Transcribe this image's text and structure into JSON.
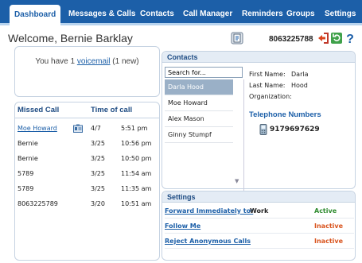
{
  "nav": {
    "tabs": [
      {
        "label": "Dashboard"
      },
      {
        "label": "Messages & Calls"
      },
      {
        "label": "Contacts"
      },
      {
        "label": "Call Manager"
      },
      {
        "label": "Reminders"
      },
      {
        "label": "Groups"
      },
      {
        "label": "Settings"
      }
    ]
  },
  "header": {
    "welcome": "Welcome, Bernie Barklay",
    "phone_number": "8063225788",
    "icons": [
      "phone-book-icon",
      "exit-icon",
      "refresh-icon",
      "help-icon"
    ]
  },
  "voicemail": {
    "prefix": "You have 1 ",
    "link": "voicemail",
    "suffix": " (1 new)"
  },
  "missed_calls": {
    "col_caller": "Missed Call",
    "col_time": "Time of call",
    "rows": [
      {
        "caller": "Moe Howard",
        "date": "4/7",
        "time": "5:51 pm",
        "link": true,
        "contact_icon": true
      },
      {
        "caller": "Bernie",
        "date": "3/25",
        "time": "10:56 pm",
        "link": false,
        "contact_icon": false
      },
      {
        "caller": "Bernie",
        "date": "3/25",
        "time": "10:50 pm",
        "link": false,
        "contact_icon": false
      },
      {
        "caller": "5789",
        "date": "3/25",
        "time": "11:54 am",
        "link": false,
        "contact_icon": false
      },
      {
        "caller": "5789",
        "date": "3/25",
        "time": "11:35 am",
        "link": false,
        "contact_icon": false
      },
      {
        "caller": "8063225789",
        "date": "3/20",
        "time": "10:51 am",
        "link": false,
        "contact_icon": false
      }
    ]
  },
  "contacts": {
    "title": "Contacts",
    "search_value": "Search for...",
    "list": [
      "Darla Hood",
      "Moe Howard",
      "Alex Mason",
      "Ginny Stumpf"
    ],
    "selected_index": 0,
    "details": {
      "first_name_label": "First Name:",
      "first_name": "Darla",
      "last_name_label": "Last Name:",
      "last_name": "Hood",
      "organization_label": "Organization:",
      "organization": "",
      "telephone_header": "Telephone Numbers",
      "telephone": "9179697629"
    }
  },
  "settings": {
    "title": "Settings",
    "rows": [
      {
        "name": "Forward Immediately to:",
        "value": "Work",
        "status": "Active",
        "status_color": "#2e8b2e"
      },
      {
        "name": "Follow Me",
        "value": "",
        "status": "Inactive",
        "status_color": "#d9541e"
      },
      {
        "name": "Reject Anonymous Calls",
        "value": "",
        "status": "Inactive",
        "status_color": "#d9541e"
      }
    ]
  },
  "colors": {
    "nav_bg": "#1c5fa8",
    "panel_header_bg": "#e4ecf5",
    "selected_contact_bg": "#9ab0c7",
    "active": "#2e8b2e",
    "inactive": "#d9541e"
  }
}
